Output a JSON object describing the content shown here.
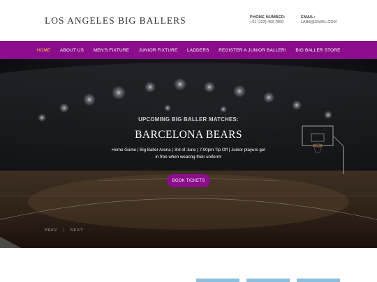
{
  "header": {
    "site_title": "LOS ANGELES BIG BALLERS",
    "phone_label": "PHONE NUMBER:",
    "phone_value": "+61 (123) 456 7890",
    "email_label": "EMAIL:",
    "email_value": "LABB@GMAIL.COM"
  },
  "nav": {
    "items": [
      {
        "label": "HOME"
      },
      {
        "label": "ABOUT US"
      },
      {
        "label": "MEN'S FIXTURE"
      },
      {
        "label": "JUNIOR FIXTURE"
      },
      {
        "label": "LADDERS"
      },
      {
        "label": "REGISTER A JUNIOR BALLER!"
      },
      {
        "label": "BIG BALLER STORE"
      }
    ],
    "active_index": 0
  },
  "hero": {
    "subtitle": "UPCOMING BIG BALLER MATCHES:",
    "title": "BARCELONA BEARS",
    "description": "Home Game | Big Baller Arena | 3rd of June | 7:00pm Tip Off | Junior players get in free when wearing their uniform!",
    "button_label": "BOOK TICKETS",
    "prev_label": "PREV",
    "separator": "|",
    "next_label": "NEXT"
  },
  "colors": {
    "brand_purple": "#8b0d8b",
    "active_nav": "#f7c948",
    "tile_blue": "#8fbedc"
  }
}
